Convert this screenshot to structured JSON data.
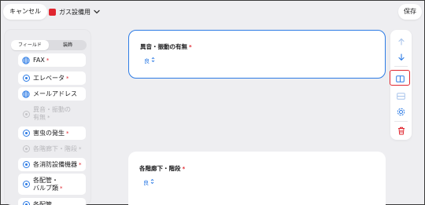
{
  "topbar": {
    "cancel_label": "キャンセル",
    "form_name": "ガス設備用",
    "save_label": "保存"
  },
  "left_panel": {
    "tabs": [
      "フィールド",
      "装飾"
    ],
    "active_tab": 0,
    "items": [
      {
        "icon": "globe-icon",
        "label": "FAX",
        "required": true,
        "disabled": false
      },
      {
        "icon": "radio-icon",
        "label": "エレベータ",
        "required": true,
        "disabled": false
      },
      {
        "icon": "globe-icon",
        "label": "メールアドレス",
        "required": false,
        "disabled": false
      },
      {
        "icon": "radio-icon",
        "label": "異音・振動の",
        "label2": "有無",
        "required": true,
        "disabled": true
      },
      {
        "icon": "radio-icon",
        "label": "害虫の発生",
        "required": true,
        "disabled": false
      },
      {
        "icon": "radio-icon",
        "label": "各階廊下・階段",
        "required": true,
        "disabled": true
      },
      {
        "icon": "radio-icon",
        "label": "各消防設備機器",
        "required": true,
        "disabled": false
      },
      {
        "icon": "radio-icon",
        "label": "各配管・",
        "label2": "バルブ類",
        "required": true,
        "disabled": false
      },
      {
        "icon": "radio-icon",
        "label": "各配管",
        "required": false,
        "disabled": false
      }
    ]
  },
  "cards": [
    {
      "title": "異音・振動の有無",
      "required": true,
      "value": "良",
      "selected": true
    },
    {
      "title": "各階廊下・階段",
      "required": true,
      "value": "良",
      "selected": false
    }
  ],
  "required_mark": "*",
  "toolbar": {
    "buttons": [
      "arrow-up-icon",
      "arrow-down-icon",
      "split-view-icon",
      "layout-icon",
      "settings-icon",
      "trash-icon"
    ],
    "highlighted": "split-view-icon",
    "colors": {
      "accent": "#2c7be5",
      "danger": "#e0262f"
    }
  }
}
